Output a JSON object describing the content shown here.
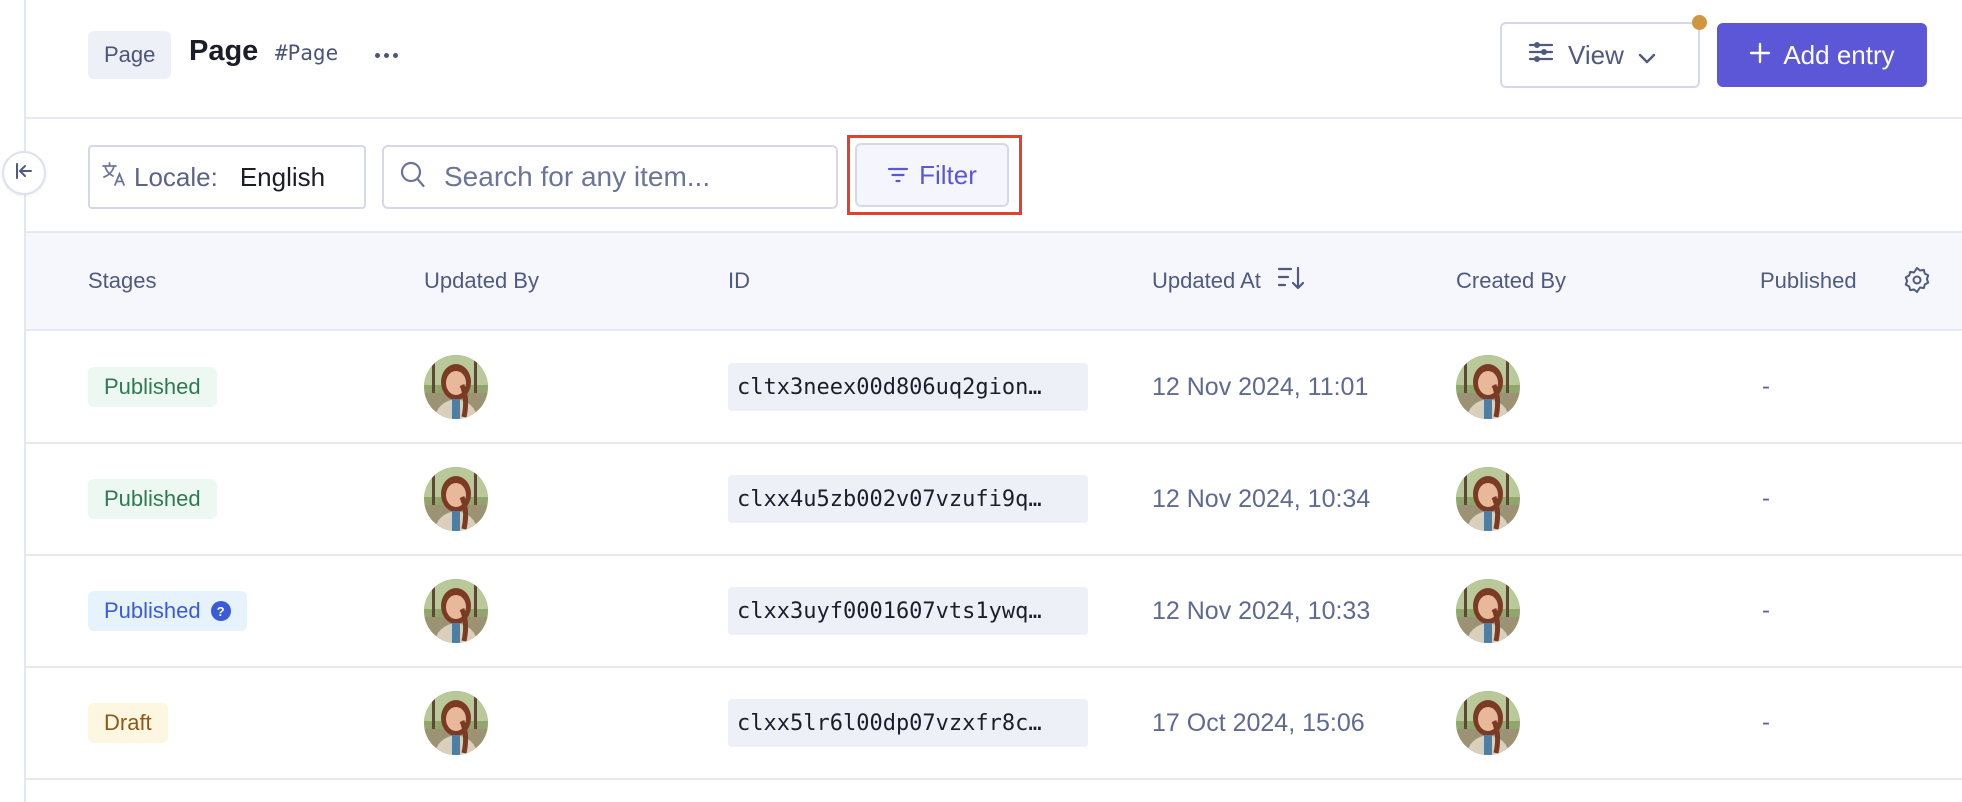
{
  "header": {
    "type_chip": "Page",
    "title": "Page",
    "api_id": "#Page",
    "more_icon": "ellipsis-icon",
    "view_button": {
      "label": "View",
      "icon": "sliders-icon",
      "chevron": "chevron-down-icon",
      "indicator_color": "#cf9640"
    },
    "add_button": {
      "label": "Add entry",
      "icon": "plus-icon",
      "color": "#5b57d6"
    }
  },
  "sidebar": {
    "collapse_icon": "collapse-left-icon"
  },
  "toolbar": {
    "locale": {
      "icon": "translate-icon",
      "label": "Locale:",
      "value": "English"
    },
    "search": {
      "icon": "search-icon",
      "placeholder": "Search for any item...",
      "value": ""
    },
    "filter": {
      "label": "Filter",
      "icon": "filter-icon",
      "highlighted": true,
      "highlight_color": "#e2412c"
    }
  },
  "table": {
    "columns": [
      {
        "label": "Stages"
      },
      {
        "label": "Updated By"
      },
      {
        "label": "ID"
      },
      {
        "label": "Updated At",
        "sort_icon": "sort-descending-icon"
      },
      {
        "label": "Created By"
      },
      {
        "label": "Published"
      }
    ],
    "settings_icon": "gear-icon",
    "rows": [
      {
        "stage": "Published",
        "stage_variant": "published",
        "id": "cltx3neex00d806uq2gion…",
        "updated_at": "12 Nov 2024, 11:01",
        "published": "-"
      },
      {
        "stage": "Published",
        "stage_variant": "published",
        "id": "clxx4u5zb002v07vzufi9q…",
        "updated_at": "12 Nov 2024, 10:34",
        "published": "-"
      },
      {
        "stage": "Published",
        "stage_variant": "published-changed",
        "stage_help": "?",
        "id": "clxx3uyf0001607vts1ywq…",
        "updated_at": "12 Nov 2024, 10:33",
        "published": "-"
      },
      {
        "stage": "Draft",
        "stage_variant": "draft",
        "id": "clxx5lr6l00dp07vzxfr8c…",
        "updated_at": "17 Oct 2024, 15:06",
        "published": "-"
      }
    ]
  }
}
